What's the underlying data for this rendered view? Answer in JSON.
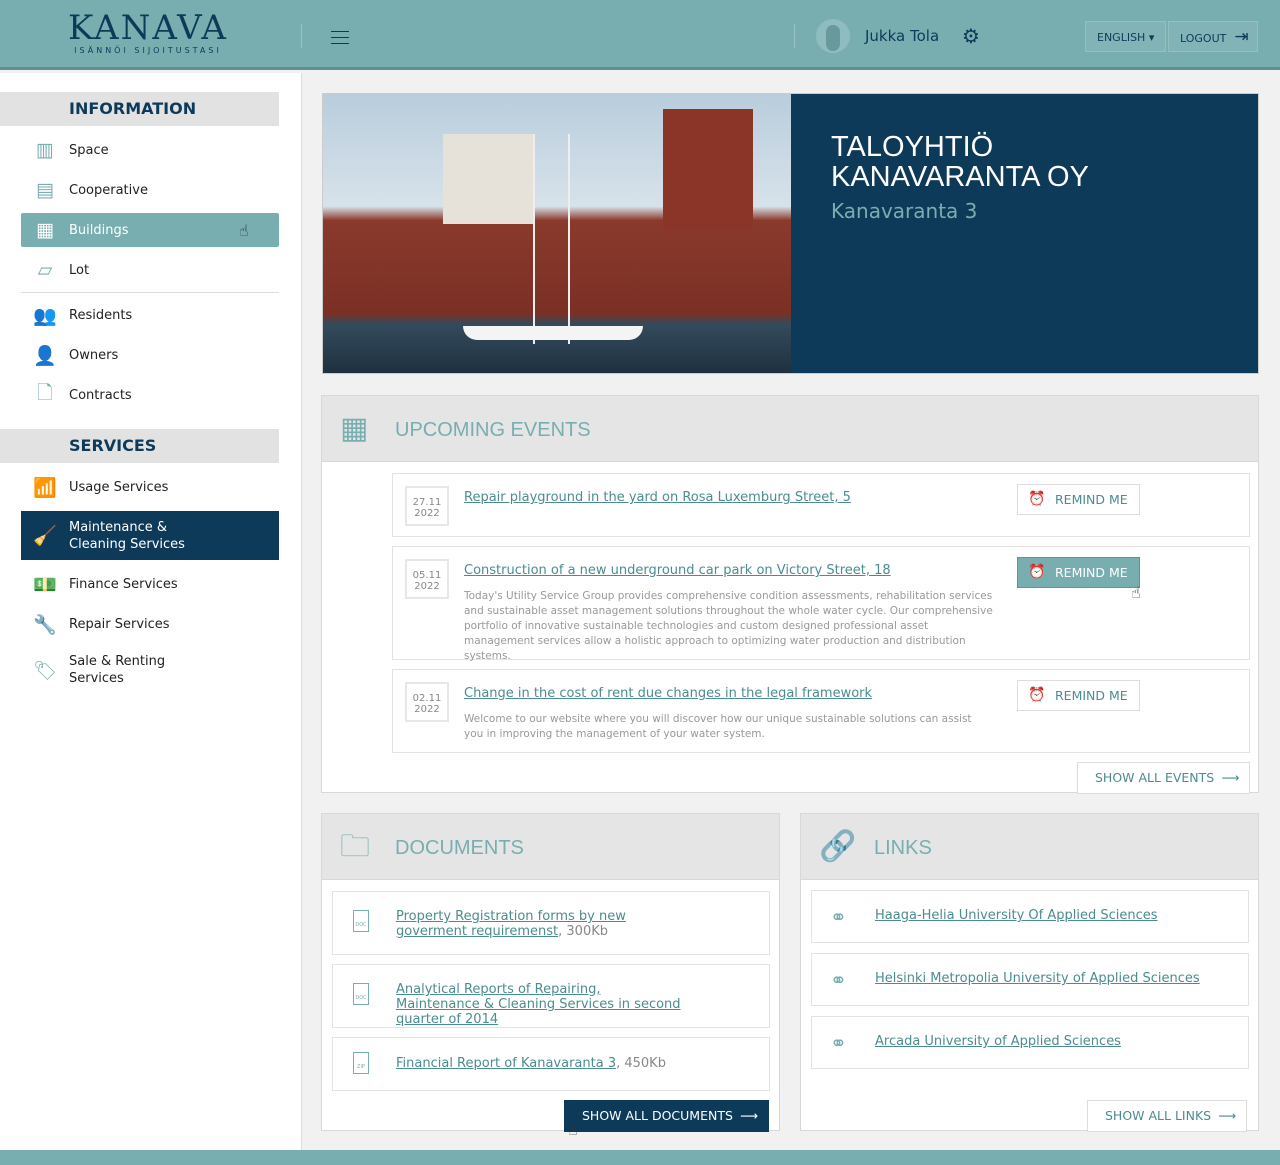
{
  "header": {
    "logo": "KANAVA",
    "logo_sub": "ISÄNNÖI SIJOITUSTASI",
    "user": "Jukka Tola",
    "language": "ENGLISH",
    "logout": "LOGOUT"
  },
  "sidebar": {
    "information_title": "INFORMATION",
    "information": [
      {
        "label": "Space",
        "icon": "space-icon"
      },
      {
        "label": "Cooperative",
        "icon": "cooperative-icon"
      },
      {
        "label": "Buildings",
        "icon": "buildings-icon"
      },
      {
        "label": "Lot",
        "icon": "lot-icon"
      },
      {
        "label": "Residents",
        "icon": "residents-icon"
      },
      {
        "label": "Owners",
        "icon": "owners-icon"
      },
      {
        "label": "Contracts",
        "icon": "contracts-icon"
      }
    ],
    "services_title": "SERVICES",
    "services": [
      {
        "label": "Usage Services"
      },
      {
        "label": "Maintenance & Cleaning Services"
      },
      {
        "label": "Finance Services"
      },
      {
        "label": "Repair Services"
      },
      {
        "label": "Sale & Renting Services"
      }
    ]
  },
  "hero": {
    "title_line1": "TALOYHTIÖ",
    "title_line2": "KANAVARANTA OY",
    "address": "Kanavaranta 3"
  },
  "events": {
    "title": "UPCOMING EVENTS",
    "remind_label": "REMIND ME",
    "show_all": "SHOW ALL EVENTS",
    "items": [
      {
        "day": "27.11",
        "year": "2022",
        "title": "Repair playground in the yard on Rosa Luxemburg Street, 5",
        "desc": ""
      },
      {
        "day": "05.11",
        "year": "2022",
        "title": "Construction of a new underground car park on Victory Street, 18",
        "desc": "Today's Utility Service Group provides comprehensive condition assessments, rehabilitation services and sustainable asset management solutions throughout the whole water cycle. Our comprehensive portfolio of innovative sustainable technologies and custom designed professional asset management services allow a holistic approach to optimizing water production and distribution systems."
      },
      {
        "day": "02.11",
        "year": "2022",
        "title": "Change in the cost of rent due changes in the legal framework",
        "desc": "Welcome to our website where you will discover how our unique sustainable solutions can assist you in improving the management of your water system."
      }
    ]
  },
  "documents": {
    "title": "DOCUMENTS",
    "show_all": "SHOW ALL DOCUMENTS",
    "items": [
      {
        "type": "DOC",
        "title": "Property Registration forms by new goverment requiremenst",
        "size": ", 300Kb"
      },
      {
        "type": "DOC",
        "title": "Analytical Reports of Repairing, Maintenance & Cleaning Services in second quarter of 2014",
        "size": ""
      },
      {
        "type": "ZIP",
        "title": "Financial Report of Kanavaranta 3",
        "size": ", 450Kb"
      }
    ]
  },
  "links": {
    "title": "LINKS",
    "show_all": "SHOW ALL LINKS",
    "items": [
      "Haaga-Helia University Of Applied Sciences",
      "Helsinki Metropolia University of Applied Sciences",
      "Arcada University of Applied Sciences"
    ]
  }
}
